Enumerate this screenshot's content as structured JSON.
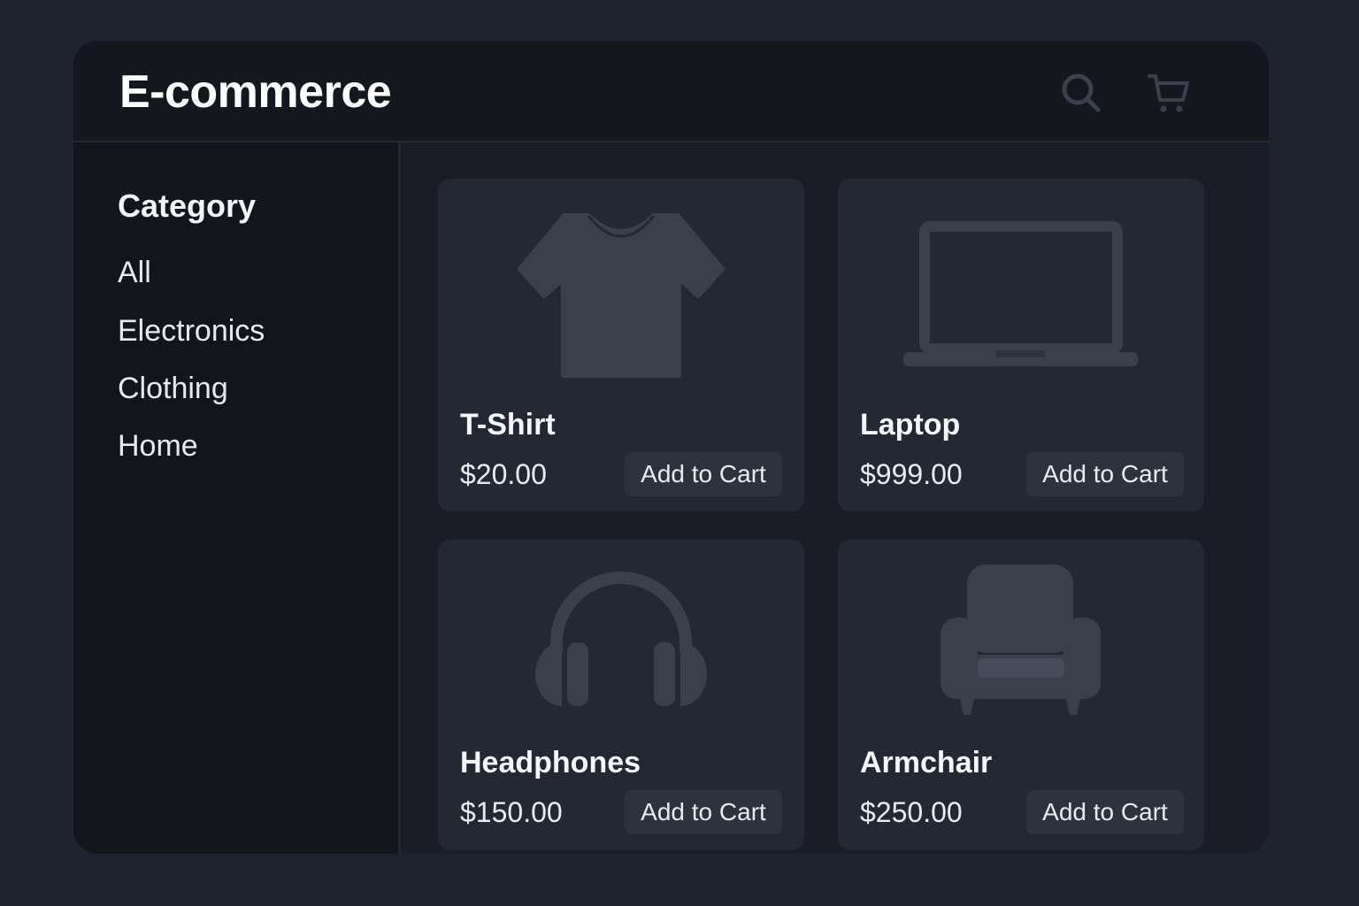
{
  "header": {
    "title": "E-commerce",
    "search_icon": "search-icon",
    "cart_icon": "cart-icon"
  },
  "sidebar": {
    "heading": "Category",
    "items": [
      {
        "label": "All"
      },
      {
        "label": "Electronics"
      },
      {
        "label": "Clothing"
      },
      {
        "label": "Home"
      }
    ]
  },
  "products": [
    {
      "name": "T-Shirt",
      "price": "$20.00",
      "button": "Add to Cart",
      "icon": "tshirt-icon"
    },
    {
      "name": "Laptop",
      "price": "$999.00",
      "button": "Add to Cart",
      "icon": "laptop-icon"
    },
    {
      "name": "Headphones",
      "price": "$150.00",
      "button": "Add to Cart",
      "icon": "headphones-icon"
    },
    {
      "name": "Armchair",
      "price": "$250.00",
      "button": "Add to Cart",
      "icon": "armchair-icon"
    }
  ],
  "colors": {
    "page_bg": "#1f2330",
    "header_bg": "#14171d",
    "sidebar_bg": "#12151b",
    "card_bg": "#242833",
    "icon_fill": "#3a3f4c",
    "button_bg": "#2e323d"
  }
}
